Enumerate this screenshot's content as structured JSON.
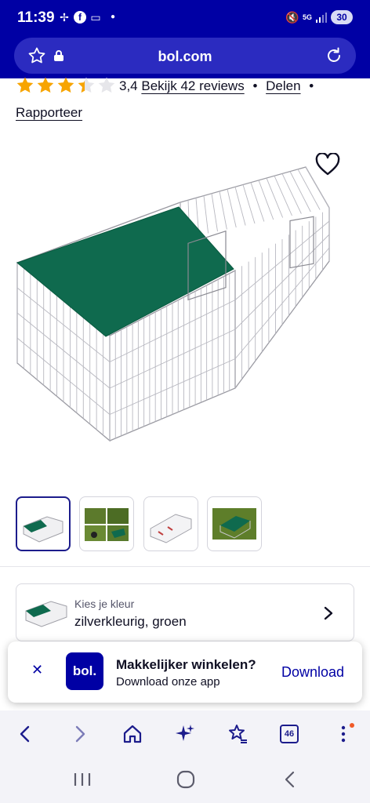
{
  "status_bar": {
    "time": "11:39",
    "network": "5G",
    "battery": "30"
  },
  "browser": {
    "url": "bol.com",
    "tab_count": "46",
    "icons": [
      "back-icon",
      "forward-icon",
      "home-icon",
      "sparkle-icon",
      "favorites-icon",
      "tabs-icon",
      "menu-icon"
    ]
  },
  "product": {
    "rating": 3.4,
    "rating_text": "3,4",
    "reviews_link": "Bekijk 42 reviews",
    "share_link": "Delen",
    "report_link": "Rapporteer",
    "separator": "•",
    "thumbnails": [
      "thumb-cage-white",
      "thumb-cage-grass-collage",
      "thumb-cage-open",
      "thumb-cage-on-grass"
    ],
    "selected_thumbnail": 0
  },
  "color_choice": {
    "label": "Kies je kleur",
    "value": "zilverkleurig, groen"
  },
  "app_banner": {
    "logo_text": "bol.",
    "title": "Makkelijker winkelen?",
    "subtitle": "Download onze app",
    "download_label": "Download"
  },
  "colors": {
    "brand_blue": "#0000a4",
    "star_orange": "#f7a400",
    "star_empty": "#e6e6ea",
    "cover_green": "#0f6a4e"
  }
}
